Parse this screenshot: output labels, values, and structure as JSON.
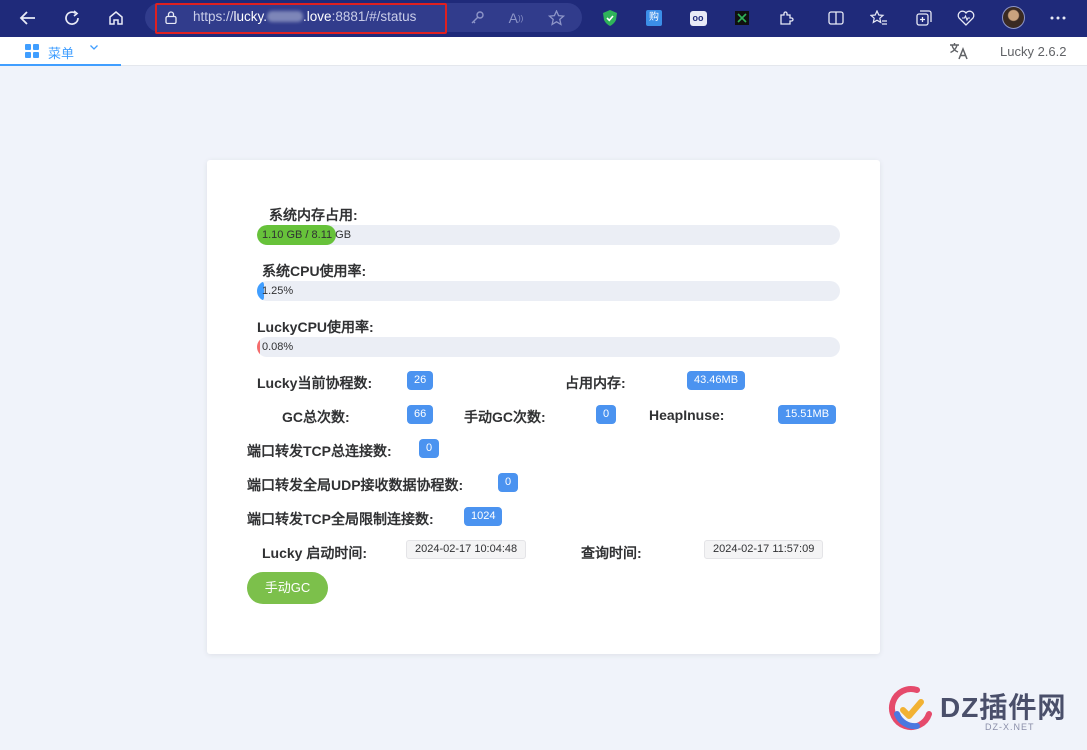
{
  "browser": {
    "url_prefix": "https://",
    "url_host_a": "lucky.",
    "url_host_b": ".love",
    "url_suffix": ":8881/#/status"
  },
  "header": {
    "menu_label": "菜单",
    "version": "Lucky 2.6.2"
  },
  "colors": {
    "browser_bar": "#1f2a7a",
    "accent": "#409eff",
    "memory_fill": "#67c23a",
    "badge": "#4b93f0",
    "gc_button": "#7cc04b"
  },
  "status": {
    "mem_label": "系统内存占用:",
    "mem_text": "1.10 GB / 8.11 GB",
    "mem_fraction": 0.1356,
    "cpu_label": "系统CPU使用率:",
    "cpu_text": "1.25%",
    "cpu_fraction": 0.0125,
    "lucky_cpu_label": "LuckyCPU使用率:",
    "lucky_cpu_text": "0.08%",
    "lucky_cpu_fraction": 0.0008,
    "goroutines_label": "Lucky当前协程数:",
    "goroutines_value": "26",
    "mem_used_label": "占用内存:",
    "mem_used_value": "43.46MB",
    "gc_count_label": "GC总次数:",
    "gc_count_value": "66",
    "manual_gc_label": "手动GC次数:",
    "manual_gc_value": "0",
    "heap_label": "HeapInuse:",
    "heap_value": "15.51MB",
    "tcp_conn_label": "端口转发TCP总连接数:",
    "tcp_conn_value": "0",
    "udp_label": "端口转发全局UDP接收数据协程数:",
    "udp_value": "0",
    "tcp_limit_label": "端口转发TCP全局限制连接数:",
    "tcp_limit_value": "1024",
    "start_time_label": "Lucky 启动时间:",
    "start_time_value": "2024-02-17 10:04:48",
    "query_time_label": "查询时间:",
    "query_time_value": "2024-02-17 11:57:09",
    "gc_button": "手动GC"
  },
  "watermark": {
    "title": "DZ插件网",
    "sub": "DZ-X.NET"
  }
}
